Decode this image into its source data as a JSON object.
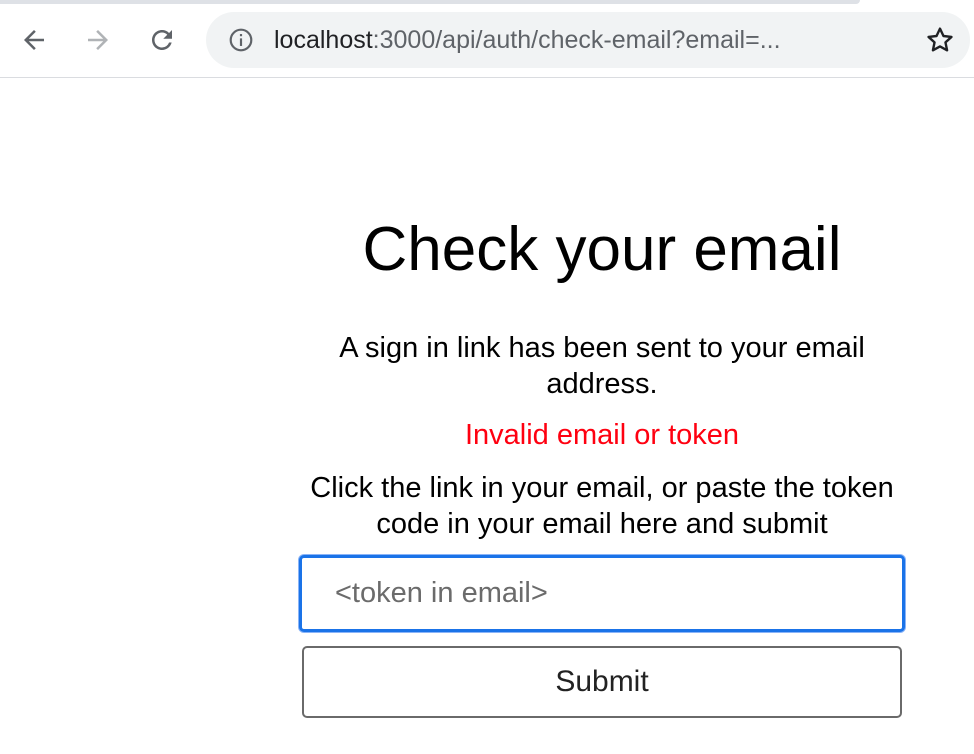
{
  "browser": {
    "url_host": "localhost",
    "url_rest": ":3000/api/auth/check-email?email=...",
    "icons": {
      "back": "back-arrow-icon",
      "forward": "forward-arrow-icon",
      "reload": "reload-icon",
      "info": "info-icon",
      "bookmark": "star-icon"
    }
  },
  "page": {
    "title": "Check your email",
    "description": "A sign in link has been sent to your email address.",
    "error": "Invalid email or token",
    "instructions": "Click the link in your email, or paste the token code in your email here and submit",
    "token_input": {
      "placeholder": "<token in email>",
      "value": ""
    },
    "submit_label": "Submit"
  },
  "colors": {
    "error": "#ff0010",
    "focus_ring": "#1a73e8"
  }
}
